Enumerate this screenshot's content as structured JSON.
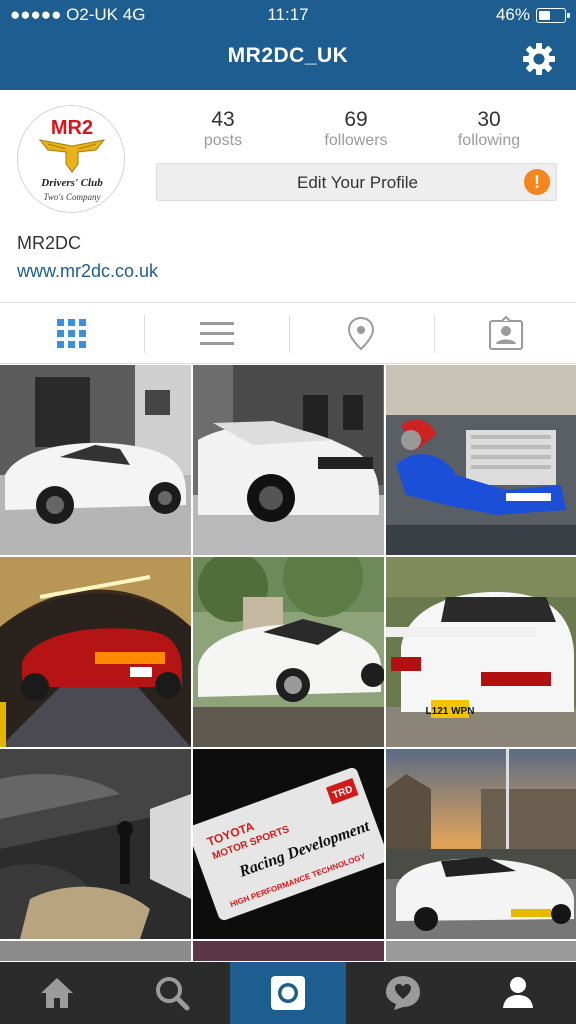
{
  "status_bar": {
    "carrier": "●●●●● O2-UK  4G",
    "time": "11:17",
    "battery": "46%",
    "battery_level": 0.46
  },
  "nav": {
    "title": "MR2DC_UK",
    "settings_icon": "gear-icon"
  },
  "profile": {
    "avatar": {
      "logo_text": "MR2",
      "logo_sub": "Drivers' Club",
      "logo_tag": "Two's Company"
    },
    "stats": [
      {
        "value": "43",
        "label": "posts"
      },
      {
        "value": "69",
        "label": "followers"
      },
      {
        "value": "30",
        "label": "following"
      }
    ],
    "edit_button": "Edit Your Profile",
    "alert_badge": "!",
    "name": "MR2DC",
    "website": "www.mr2dc.co.uk"
  },
  "view_tabs": [
    {
      "icon": "grid-icon",
      "active": true
    },
    {
      "icon": "list-icon",
      "active": false
    },
    {
      "icon": "location-pin-icon",
      "active": false
    },
    {
      "icon": "tagged-person-icon",
      "active": false
    }
  ],
  "photos": [
    {
      "description_icon": "white-mr2-side-bw",
      "scene": "bw-white-car"
    },
    {
      "description_icon": "white-mr2-rear-bw",
      "scene": "bw-white-car"
    },
    {
      "description_icon": "engine-bay-blue",
      "scene": "engine"
    },
    {
      "description_icon": "red-mr2-tunnel",
      "scene": "red-tunnel"
    },
    {
      "description_icon": "white-mr2-trees",
      "scene": "white-trees"
    },
    {
      "description_icon": "white-mr2-rear-spoiler",
      "scene": "white-rear"
    },
    {
      "description_icon": "interior-gearstick",
      "scene": "interior"
    },
    {
      "description_icon": "trd-plaque",
      "scene": "plaque"
    },
    {
      "description_icon": "white-mr2-sunset",
      "scene": "sunset"
    }
  ],
  "plaque_text": {
    "line1": "TOYOTA",
    "line2": "MOTOR SPORTS",
    "script": "Racing Development",
    "bottom": "HIGH PERFORMANCE TECHNOLOGY",
    "badge": "TRD"
  },
  "plate_text": "L121 WPN",
  "bottom_tabs": [
    {
      "icon": "home-icon",
      "active": false
    },
    {
      "icon": "search-icon",
      "active": false
    },
    {
      "icon": "camera-icon",
      "active": true
    },
    {
      "icon": "activity-heart-icon",
      "active": false
    },
    {
      "icon": "profile-icon",
      "active": false
    }
  ],
  "colors": {
    "brand_blue": "#1e5d8f",
    "tab_active_blue": "#3d8fd9",
    "alert_orange": "#f5851f",
    "bottom_bar": "#2b2b2b"
  }
}
